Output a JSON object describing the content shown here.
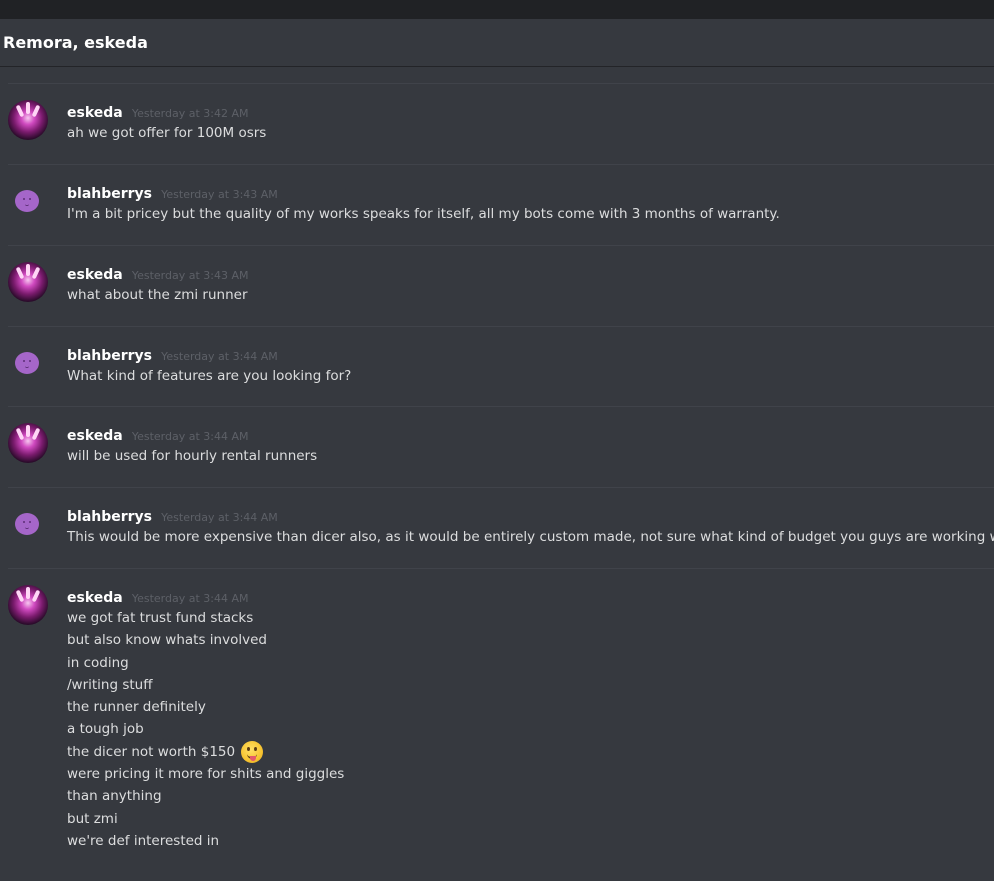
{
  "header": {
    "title": "Remora, eskeda"
  },
  "messages": [
    {
      "author": "eskeda",
      "avatar_icon": "eskeda-avatar-icon",
      "timestamp": "Yesterday at 3:42 AM",
      "lines": [
        "ah we got offer for 100M osrs"
      ]
    },
    {
      "author": "blahberrys",
      "avatar_icon": "purple-blob-avatar-icon",
      "timestamp": "Yesterday at 3:43 AM",
      "lines": [
        "I'm a bit pricey but the quality of my works speaks for itself, all my bots come with 3 months of warranty."
      ]
    },
    {
      "author": "eskeda",
      "avatar_icon": "eskeda-avatar-icon",
      "timestamp": "Yesterday at 3:43 AM",
      "lines": [
        "what about the zmi runner"
      ]
    },
    {
      "author": "blahberrys",
      "avatar_icon": "purple-blob-avatar-icon",
      "timestamp": "Yesterday at 3:44 AM",
      "lines": [
        "What kind of features are you looking for?"
      ]
    },
    {
      "author": "eskeda",
      "avatar_icon": "eskeda-avatar-icon",
      "timestamp": "Yesterday at 3:44 AM",
      "lines": [
        "will be used for hourly rental runners"
      ]
    },
    {
      "author": "blahberrys",
      "avatar_icon": "purple-blob-avatar-icon",
      "timestamp": "Yesterday at 3:44 AM",
      "lines": [
        "This would be more expensive than dicer also, as it would be entirely custom made, not sure what kind of budget you guys are working with"
      ]
    },
    {
      "author": "eskeda",
      "avatar_icon": "eskeda-avatar-icon",
      "timestamp": "Yesterday at 3:44 AM",
      "lines": [
        "we got fat trust fund stacks",
        "but also know whats involved",
        "in coding",
        "/writing stuff",
        "the runner definitely",
        "a tough job",
        "the dicer not worth $150",
        "were pricing it more for shits and giggles",
        "than anything",
        "but zmi",
        "we're def interested in"
      ],
      "emoji_after_line": 6,
      "emoji_icon": "stuck-out-tongue-emoji-icon"
    }
  ],
  "colors": {
    "background": "#36393f",
    "topbar": "#202225",
    "username": "#ffffff",
    "timestamp": "#5d6067",
    "text": "#dcddde",
    "divider": "#40434a"
  }
}
